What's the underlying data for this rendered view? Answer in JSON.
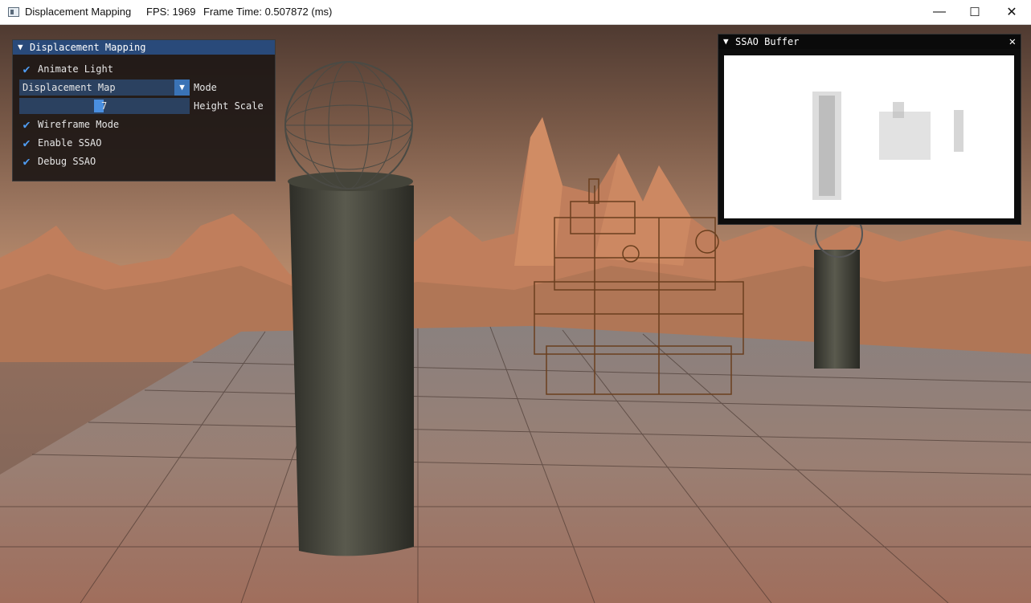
{
  "titlebar": {
    "app_title": "Displacement Mapping",
    "fps": "FPS: 1969",
    "frame_time": "Frame Time: 0.507872 (ms)",
    "minimize_glyph": "—",
    "maximize_glyph": "☐",
    "close_glyph": "✕"
  },
  "panel": {
    "title": "Displacement Mapping",
    "collapse_glyph": "▼",
    "animate_light_label": "Animate Light",
    "mode_value": "Displacement Map",
    "mode_label": "Mode",
    "height_scale_value": "7",
    "height_scale_label": "Height Scale",
    "wireframe_label": "Wireframe Mode",
    "ssao_label": "Enable SSAO",
    "debug_ssao_label": "Debug SSAO",
    "check_glyph": "✔",
    "dropdown_glyph": "▼"
  },
  "ssao_window": {
    "title": "SSAO Buffer",
    "collapse_glyph": "▼",
    "close_glyph": "✕"
  },
  "colors": {
    "imgui_title_bg": "#294a7a",
    "checkmark": "#4f9bf0",
    "frame_bg": "#2b4160"
  }
}
